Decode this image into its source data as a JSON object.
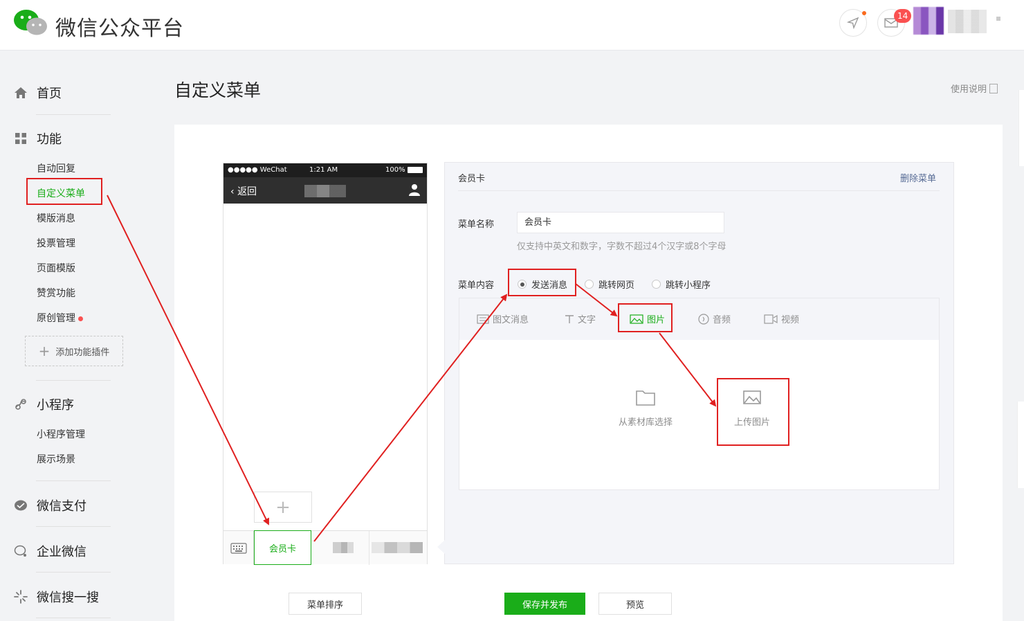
{
  "header": {
    "brand": "微信公众平台",
    "mail_badge": "14"
  },
  "sidebar": {
    "home": "首页",
    "features": "功能",
    "feature_items": [
      "自动回复",
      "自定义菜单",
      "模版消息",
      "投票管理",
      "页面模版",
      "赞赏功能",
      "原创管理"
    ],
    "add_plugin": "添加功能插件",
    "miniprogram": "小程序",
    "miniprogram_items": [
      "小程序管理",
      "展示场景"
    ],
    "wechat_pay": "微信支付",
    "work_wechat": "企业微信",
    "search": "微信搜一搜"
  },
  "page": {
    "title": "自定义菜单",
    "help": "使用说明"
  },
  "phone": {
    "carrier": "●●●●● WeChat",
    "time": "1:21 AM",
    "battery": "100%",
    "back": "返回",
    "plus": "+",
    "menu1": "会员卡"
  },
  "editor": {
    "title": "会员卡",
    "delete": "删除菜单",
    "name_label": "菜单名称",
    "name_value": "会员卡",
    "name_hint": "仅支持中英文和数字，字数不超过4个汉字或8个字母",
    "content_label": "菜单内容",
    "radio_options": [
      "发送消息",
      "跳转网页",
      "跳转小程序"
    ],
    "selected_radio": "发送消息",
    "tabs": [
      "图文消息",
      "文字",
      "图片",
      "音频",
      "视频"
    ],
    "active_tab": "图片",
    "pick_library": "从素材库选择",
    "pick_upload": "上传图片"
  },
  "buttons": {
    "sort": "菜单排序",
    "publish": "保存并发布",
    "preview": "预览"
  },
  "colors": {
    "accent": "#1aad19",
    "annotation": "#e02020",
    "link": "#576b95"
  }
}
